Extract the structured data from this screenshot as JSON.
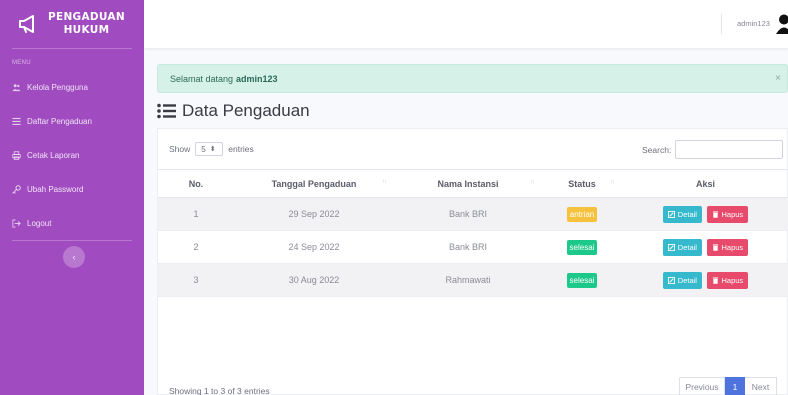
{
  "brand": {
    "line1": "PENGADUAN",
    "line2": "HUKUM",
    "icon": "megaphone-icon"
  },
  "sidebar": {
    "heading": "MENU",
    "items": [
      {
        "label": "Kelola Pengguna",
        "icon": "users-icon"
      },
      {
        "label": "Daftar Pengaduan",
        "icon": "list-icon"
      },
      {
        "label": "Cetak Laporan",
        "icon": "print-icon"
      },
      {
        "label": "Ubah Password",
        "icon": "key-icon"
      },
      {
        "label": "Logout",
        "icon": "logout-icon"
      }
    ],
    "toggle_glyph": "‹"
  },
  "topbar": {
    "username": "admin123"
  },
  "alert": {
    "text": "Selamat datang",
    "user": "admin123",
    "close": "×"
  },
  "page": {
    "title": "Data Pengaduan"
  },
  "table_controls": {
    "show_label": "Show",
    "entries_value": "5",
    "entries_label": "entries",
    "search_label": "Search:"
  },
  "table": {
    "headers": [
      "No.",
      "Tanggal Pengaduan",
      "Nama Instansi",
      "Status",
      "Aksi"
    ],
    "rows": [
      {
        "no": "1",
        "tanggal": "29 Sep 2022",
        "instansi": "Bank BRI",
        "status": "antrian"
      },
      {
        "no": "2",
        "tanggal": "24 Sep 2022",
        "instansi": "Bank BRI",
        "status": "selesai"
      },
      {
        "no": "3",
        "tanggal": "30 Aug 2022",
        "instansi": "Rahmawati",
        "status": "selesai"
      }
    ],
    "detail_label": "Detail",
    "hapus_label": "Hapus"
  },
  "footer": {
    "info": "Showing 1 to 3 of 3 entries",
    "prev": "Previous",
    "page": "1",
    "next": "Next"
  },
  "colors": {
    "sidebar": "#a04bc0",
    "alert_bg": "#d6f1e8",
    "antrian": "#f6c23e",
    "selesai": "#1cc88a",
    "detail": "#36b9cc",
    "hapus": "#e74a6b",
    "primary": "#4e73df"
  }
}
